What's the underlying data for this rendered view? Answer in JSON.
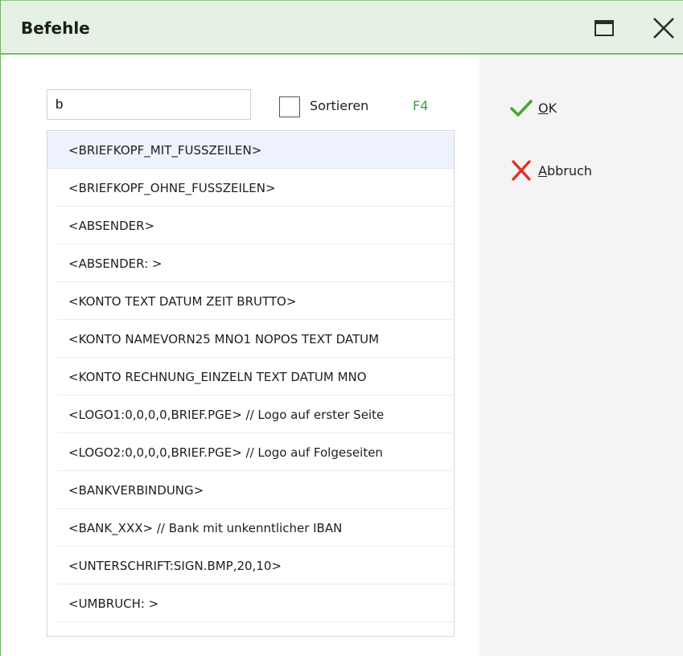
{
  "window": {
    "title": "Befehle",
    "maximize_icon": "maximize-icon",
    "close_icon": "close-icon"
  },
  "search": {
    "value": "b"
  },
  "sort": {
    "checked": false,
    "label": "Sortieren",
    "shortcut": "F4",
    "shortcut_color": "#3aa03a"
  },
  "commands": [
    "<BRIEFKOPF_MIT_FUSSZEILEN>",
    "<BRIEFKOPF_OHNE_FUSSZEILEN>",
    "<ABSENDER>",
    "<ABSENDER:            >",
    "<KONTO TEXT DATUM ZEIT BRUTTO>",
    "<KONTO NAMEVORN25 MNO1 NOPOS TEXT DATUM",
    "<KONTO RECHNUNG_EINZELN TEXT DATUM MNO",
    "<LOGO1:0,0,0,0,BRIEF.PGE> // Logo auf erster Seite",
    "<LOGO2:0,0,0,0,BRIEF.PGE> // Logo auf Folgeseiten",
    "<BANKVERBINDUNG>",
    "<BANK_XXX> // Bank mit unkenntlicher IBAN",
    "<UNTERSCHRIFT:SIGN.BMP,20,10>",
    "<UMBRUCH:            >"
  ],
  "selected_index": 0,
  "buttons": {
    "ok": {
      "mnemonic": "O",
      "rest": "K",
      "icon": "checkmark-icon",
      "color": "#46a82e"
    },
    "cancel": {
      "mnemonic": "A",
      "rest": "bbruch",
      "icon": "cross-icon",
      "color": "#e0302c"
    }
  },
  "colors": {
    "titlebar_bg": "#e5f1e2",
    "titlebar_border": "#79bb6a",
    "selection_bg": "#edf2fc"
  }
}
